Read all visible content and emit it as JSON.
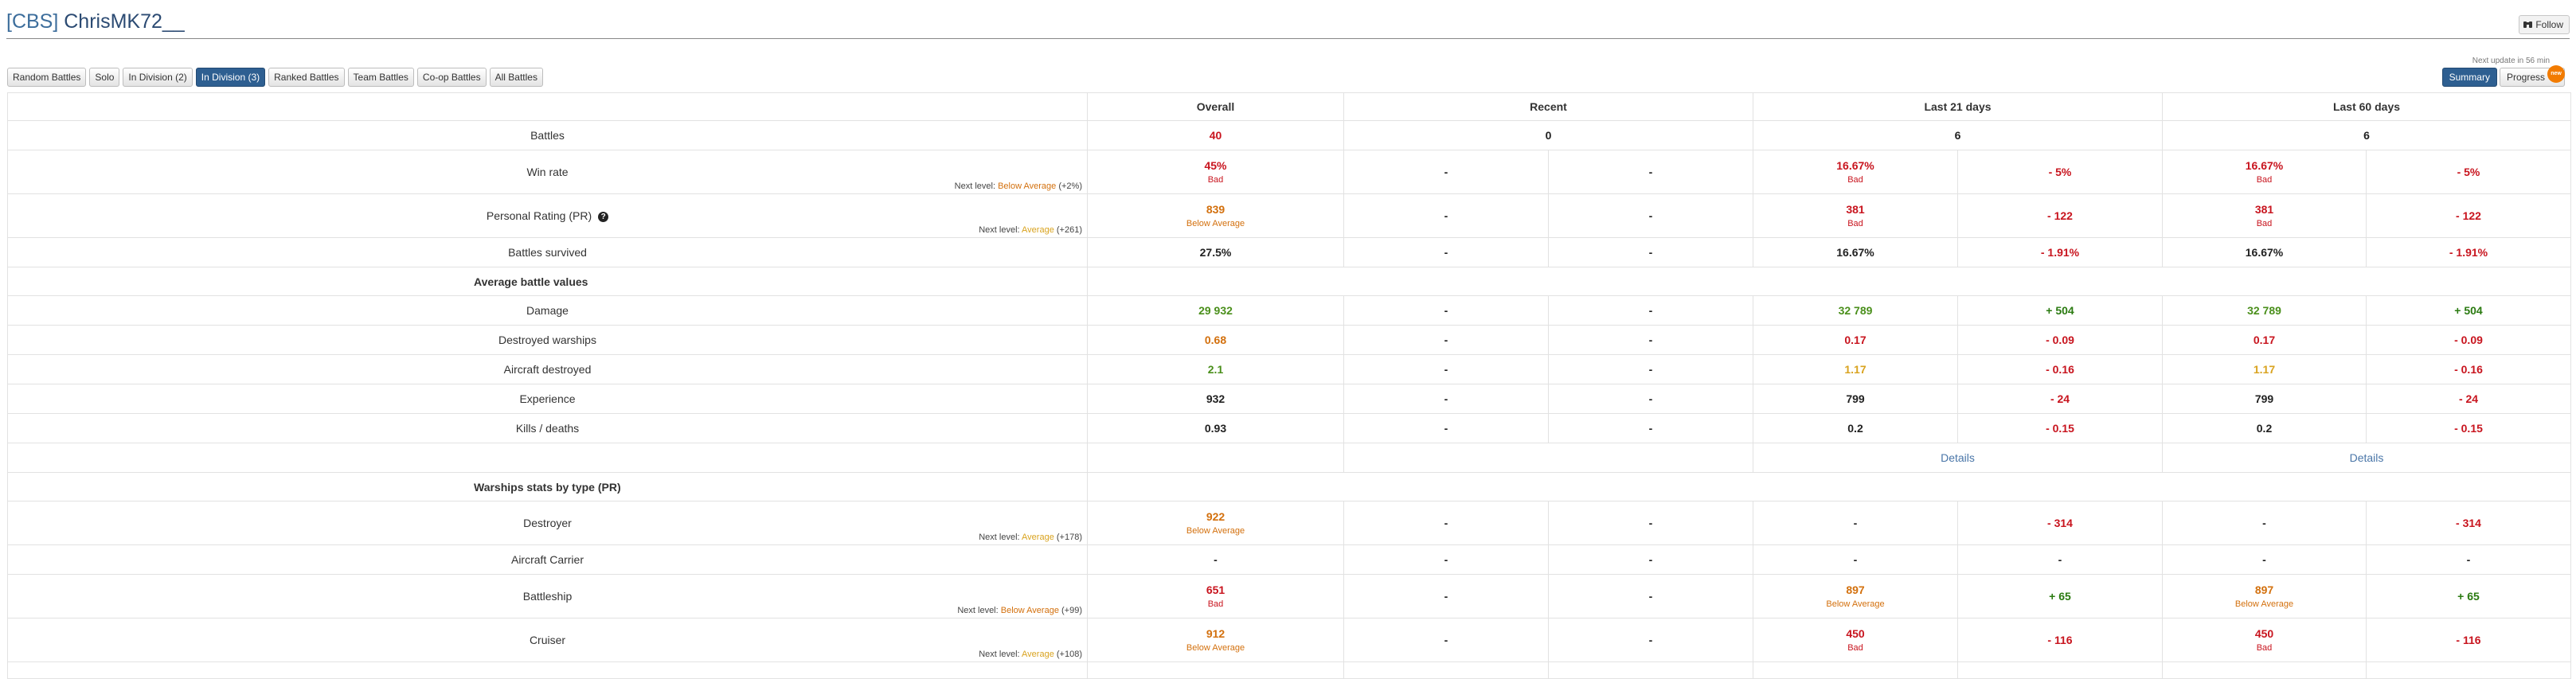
{
  "header": {
    "tag": "[CBS]",
    "name": "ChrisMK72__",
    "follow_label": "Follow"
  },
  "tabs": [
    "Random Battles",
    "Solo",
    "In Division (2)",
    "In Division (3)",
    "Ranked Battles",
    "Team Battles",
    "Co-op Battles",
    "All Battles"
  ],
  "active_tab": "In Division (3)",
  "next_update": "Next update in 56 min",
  "view_buttons": {
    "summary": "Summary",
    "progress": "Progress",
    "new_badge": "new"
  },
  "columns": {
    "overall": "Overall",
    "recent": "Recent",
    "last21": "Last 21 days",
    "last60": "Last 60 days"
  },
  "rows": {
    "battles": {
      "label": "Battles",
      "overall": "40",
      "recent": "0",
      "last21": "6",
      "last60": "6"
    },
    "winrate": {
      "label": "Win rate",
      "next_prefix": "Next level:",
      "next_level": "Below Average",
      "next_delta": "(+2%)",
      "overall": "45%",
      "overall_rating": "Bad",
      "recent": "-",
      "recent_diff": "-",
      "last21": "16.67%",
      "last21_rating": "Bad",
      "last21_diff": "- 5%",
      "last60": "16.67%",
      "last60_rating": "Bad",
      "last60_diff": "- 5%"
    },
    "pr": {
      "label": "Personal Rating (PR)",
      "help_icon": "question-circle-icon",
      "next_prefix": "Next level:",
      "next_level": "Average",
      "next_delta": "(+261)",
      "overall": "839",
      "overall_rating": "Below Average",
      "recent": "-",
      "recent_diff": "-",
      "last21": "381",
      "last21_rating": "Bad",
      "last21_diff": "- 122",
      "last60": "381",
      "last60_rating": "Bad",
      "last60_diff": "- 122"
    },
    "survived": {
      "label": "Battles survived",
      "overall": "27.5%",
      "recent": "-",
      "recent_diff": "-",
      "last21": "16.67%",
      "last21_diff": "- 1.91%",
      "last60": "16.67%",
      "last60_diff": "- 1.91%"
    }
  },
  "avg_section": "Average battle values",
  "avg_rows": [
    {
      "label": "Damage",
      "overall": "29 932",
      "recent": "-",
      "recent_diff": "-",
      "last21": "32 789",
      "last21_diff": "+ 504",
      "last60": "32 789",
      "last60_diff": "+ 504"
    },
    {
      "label": "Destroyed warships",
      "overall": "0.68",
      "recent": "-",
      "recent_diff": "-",
      "last21": "0.17",
      "last21_diff": "- 0.09",
      "last60": "0.17",
      "last60_diff": "- 0.09"
    },
    {
      "label": "Aircraft destroyed",
      "overall": "2.1",
      "recent": "-",
      "recent_diff": "-",
      "last21": "1.17",
      "last21_diff": "- 0.16",
      "last60": "1.17",
      "last60_diff": "- 0.16"
    },
    {
      "label": "Experience",
      "overall": "932",
      "recent": "-",
      "recent_diff": "-",
      "last21": "799",
      "last21_diff": "- 24",
      "last60": "799",
      "last60_diff": "- 24"
    },
    {
      "label": "Kills / deaths",
      "overall": "0.93",
      "recent": "-",
      "recent_diff": "-",
      "last21": "0.2",
      "last21_diff": "- 0.15",
      "last60": "0.2",
      "last60_diff": "- 0.15"
    }
  ],
  "details_label": "Details",
  "types_section": "Warships stats by type (PR)",
  "type_rows": [
    {
      "label": "Destroyer",
      "next_prefix": "Next level:",
      "next_level": "Average",
      "next_delta": "(+178)",
      "overall": "922",
      "overall_rating": "Below Average",
      "recent": "-",
      "recent_diff": "-",
      "last21": "-",
      "last21_diff": "- 314",
      "last60": "-",
      "last60_diff": "- 314"
    },
    {
      "label": "Aircraft Carrier",
      "overall": "-",
      "recent": "-",
      "recent_diff": "-",
      "last21": "-",
      "last21_diff": "-",
      "last60": "-",
      "last60_diff": "-"
    },
    {
      "label": "Battleship",
      "next_prefix": "Next level:",
      "next_level": "Below Average",
      "next_delta": "(+99)",
      "overall": "651",
      "overall_rating": "Bad",
      "recent": "-",
      "recent_diff": "-",
      "last21": "897",
      "last21_rating": "Below Average",
      "last21_diff": "+ 65",
      "last60": "897",
      "last60_rating": "Below Average",
      "last60_diff": "+ 65"
    },
    {
      "label": "Cruiser",
      "next_prefix": "Next level:",
      "next_level": "Average",
      "next_delta": "(+108)",
      "overall": "912",
      "overall_rating": "Below Average",
      "recent": "-",
      "recent_diff": "-",
      "last21": "450",
      "last21_rating": "Bad",
      "last21_diff": "- 116",
      "last60": "450",
      "last60_rating": "Bad",
      "last60_diff": "- 116"
    }
  ],
  "colors": {
    "link": "#4a76a8",
    "bad": "#c8141e",
    "below_average": "#d3700d",
    "average": "#d9a31f",
    "good": "#4a8f1b",
    "active_tab": "#2e5f91",
    "badge": "#f27b00"
  }
}
